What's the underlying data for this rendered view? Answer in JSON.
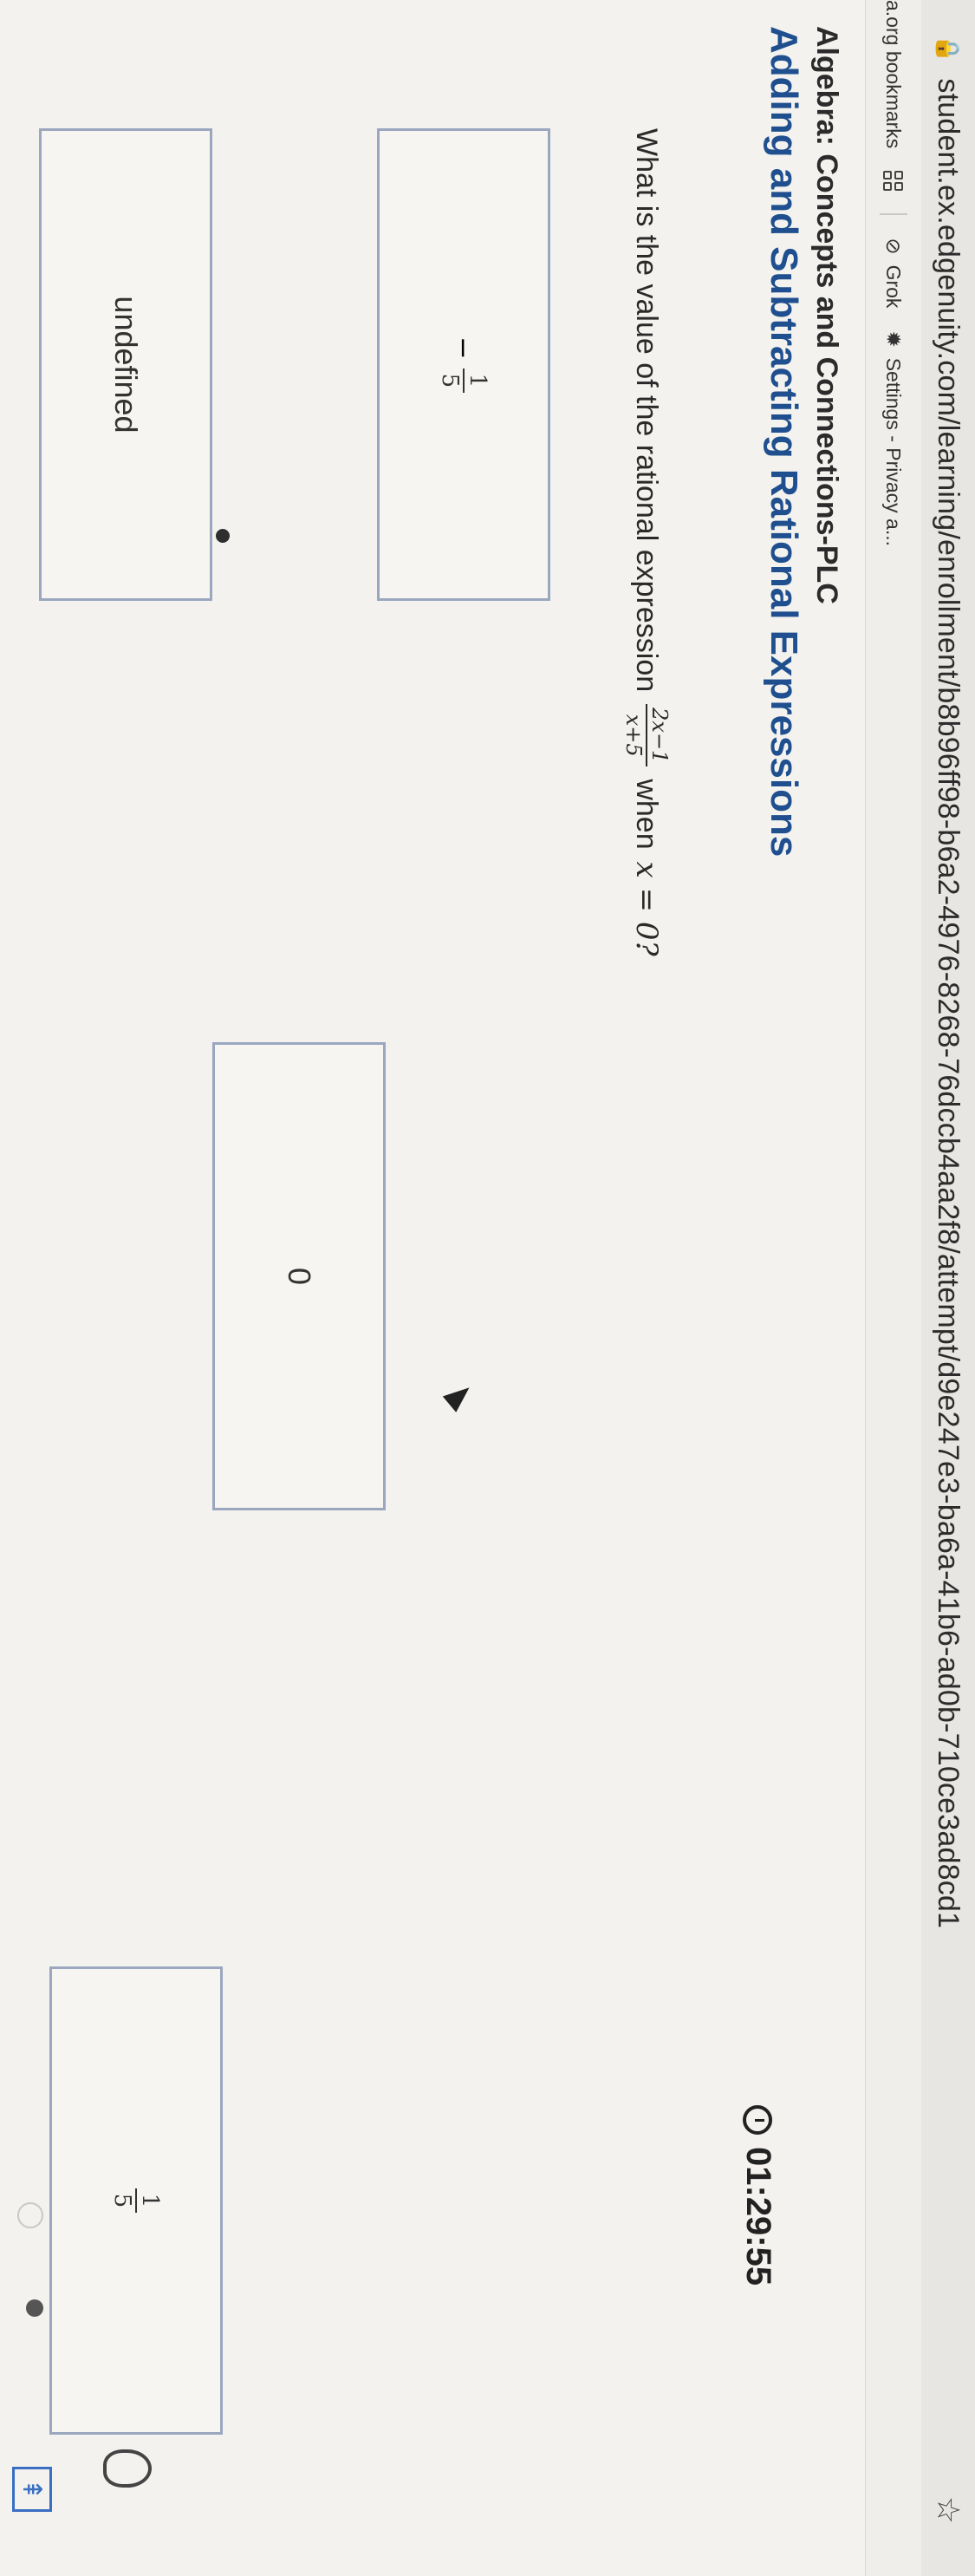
{
  "browser": {
    "url": "student.ex.edgenuity.com/learning/enrollment/b8b96ff98-b6a2-4976-8268-76dccb4aa2f8/attempt/d9e247e3-ba6a-41b6-ad0b-710ce3ad8cd1",
    "bookmarks": [
      {
        "label": "a.org bookmarks"
      },
      {
        "label": "Grok"
      },
      {
        "label": "Settings - Privacy a..."
      }
    ]
  },
  "header": {
    "course_title": "Algebra: Concepts and Connections-PLC",
    "lesson_title": "Adding and Subtracting Rational Expressions",
    "timer": "01:29:55"
  },
  "question": {
    "prefix": "What is the value of the rational expression",
    "numerator": "2x−1",
    "denominator": "x+5",
    "suffix_word": "when",
    "condition": "x = 0?"
  },
  "choices": [
    {
      "id": "A",
      "sign": "−",
      "numerator": "1",
      "denominator": "5"
    },
    {
      "id": "B",
      "value": "0"
    },
    {
      "id": "C",
      "numerator": "1",
      "denominator": "5"
    },
    {
      "id": "D",
      "value": "undefined"
    }
  ],
  "icons": {
    "lock": "lock-icon",
    "star": "star-icon",
    "timer": "clock-icon",
    "hint": "lightbulb-icon",
    "back_to_top": "arrow-up-icon"
  }
}
